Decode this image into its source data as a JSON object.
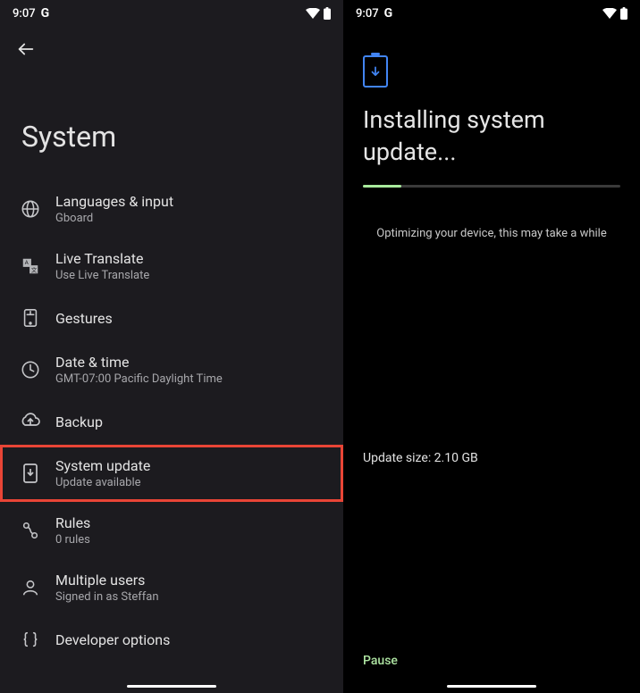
{
  "status": {
    "time": "9:07",
    "logo": "G"
  },
  "left": {
    "title": "System",
    "items": [
      {
        "title": "Languages & input",
        "subtitle": "Gboard"
      },
      {
        "title": "Live Translate",
        "subtitle": "Use Live Translate"
      },
      {
        "title": "Gestures",
        "subtitle": ""
      },
      {
        "title": "Date & time",
        "subtitle": "GMT-07:00 Pacific Daylight Time"
      },
      {
        "title": "Backup",
        "subtitle": ""
      },
      {
        "title": "System update",
        "subtitle": "Update available"
      },
      {
        "title": "Rules",
        "subtitle": "0 rules"
      },
      {
        "title": "Multiple users",
        "subtitle": "Signed in as Steffan"
      },
      {
        "title": "Developer options",
        "subtitle": ""
      }
    ]
  },
  "right": {
    "title": "Installing system update...",
    "optimize": "Optimizing your device, this may take a while",
    "updateSize": "Update size: 2.10 GB",
    "pause": "Pause",
    "progressPercent": 15
  }
}
